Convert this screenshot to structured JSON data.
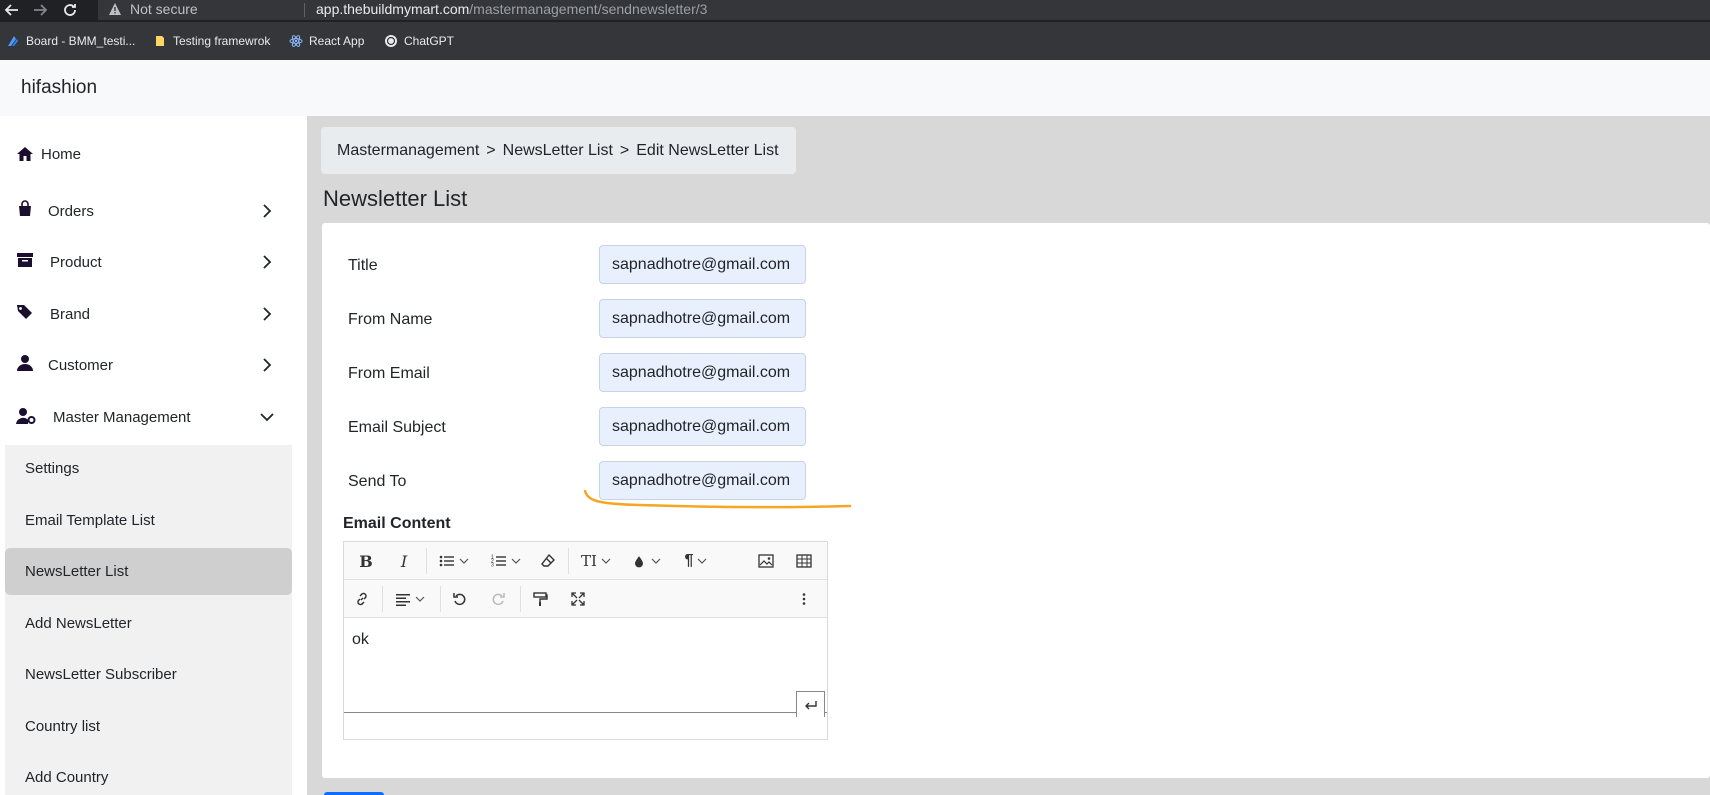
{
  "browser": {
    "not_secure": "Not secure",
    "url_host": "app.thebuildmymart.com",
    "url_path": "/mastermanagement/sendnewsletter/3",
    "bookmarks": [
      {
        "label": "Board - BMM_testi..."
      },
      {
        "label": "Testing framewrok"
      },
      {
        "label": "React App"
      },
      {
        "label": "ChatGPT"
      }
    ]
  },
  "header": {
    "brand": "hifashion"
  },
  "sidebar": {
    "items": [
      {
        "label": "Home",
        "icon": "home-icon"
      },
      {
        "label": "Orders",
        "icon": "shopping-bag-icon"
      },
      {
        "label": "Product",
        "icon": "archive-box-icon"
      },
      {
        "label": "Brand",
        "icon": "tags-icon"
      },
      {
        "label": "Customer",
        "icon": "user-icon"
      },
      {
        "label": "Master Management",
        "icon": "user-gear-icon"
      }
    ],
    "submenu": [
      {
        "label": "Settings"
      },
      {
        "label": "Email Template List"
      },
      {
        "label": "NewsLetter List"
      },
      {
        "label": "Add NewsLetter"
      },
      {
        "label": "NewsLetter Subscriber"
      },
      {
        "label": "Country list"
      },
      {
        "label": "Add Country"
      }
    ]
  },
  "breadcrumb": {
    "items": [
      "Mastermanagement",
      "NewsLetter List",
      "Edit NewsLetter List"
    ],
    "separator": ">"
  },
  "page": {
    "title": "Newsletter List"
  },
  "form": {
    "fields": [
      {
        "label": "Title",
        "value": "sapnadhotre@gmail.com"
      },
      {
        "label": "From Name",
        "value": "sapnadhotre@gmail.com"
      },
      {
        "label": "From Email",
        "value": "sapnadhotre@gmail.com"
      },
      {
        "label": "Email Subject",
        "value": "sapnadhotre@gmail.com"
      },
      {
        "label": "Send To",
        "value": "sapnadhotre@gmail.com"
      }
    ],
    "content_label": "Email Content",
    "content_text": "ok"
  },
  "colors": {
    "annotation_underline": "#f5a623",
    "active_submenu": "#cfcfcf",
    "input_bg": "#e8f0fe"
  }
}
